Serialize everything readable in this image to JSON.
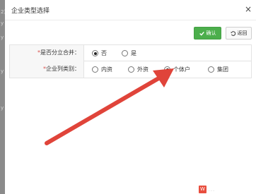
{
  "background_fragments": [
    "2)",
    "y",
    "y",
    "y",
    "y"
  ],
  "dialog": {
    "title": "企业类型选择",
    "close_glyph": "×"
  },
  "toolbar": {
    "confirm_label": "确认",
    "back_label": "返回"
  },
  "form": {
    "row1": {
      "required_mark": "*",
      "label": "是否分立合并：",
      "options": [
        {
          "label": "否",
          "checked": true
        },
        {
          "label": "是",
          "checked": false
        }
      ]
    },
    "row2": {
      "required_mark": "*",
      "label": "企业列类别：",
      "options": [
        {
          "label": "内资",
          "checked": false
        },
        {
          "label": "外资",
          "checked": false
        },
        {
          "label": "个体户",
          "checked": true
        },
        {
          "label": "集团",
          "checked": false
        }
      ]
    }
  },
  "annotation": {
    "arrow_color": "#e0443a"
  },
  "watermark": {
    "badge": "W",
    "text": "…"
  },
  "colors": {
    "confirm_green": "#4cae4c",
    "required_red": "#d9534f",
    "label_bg": "#f7f7f7"
  }
}
